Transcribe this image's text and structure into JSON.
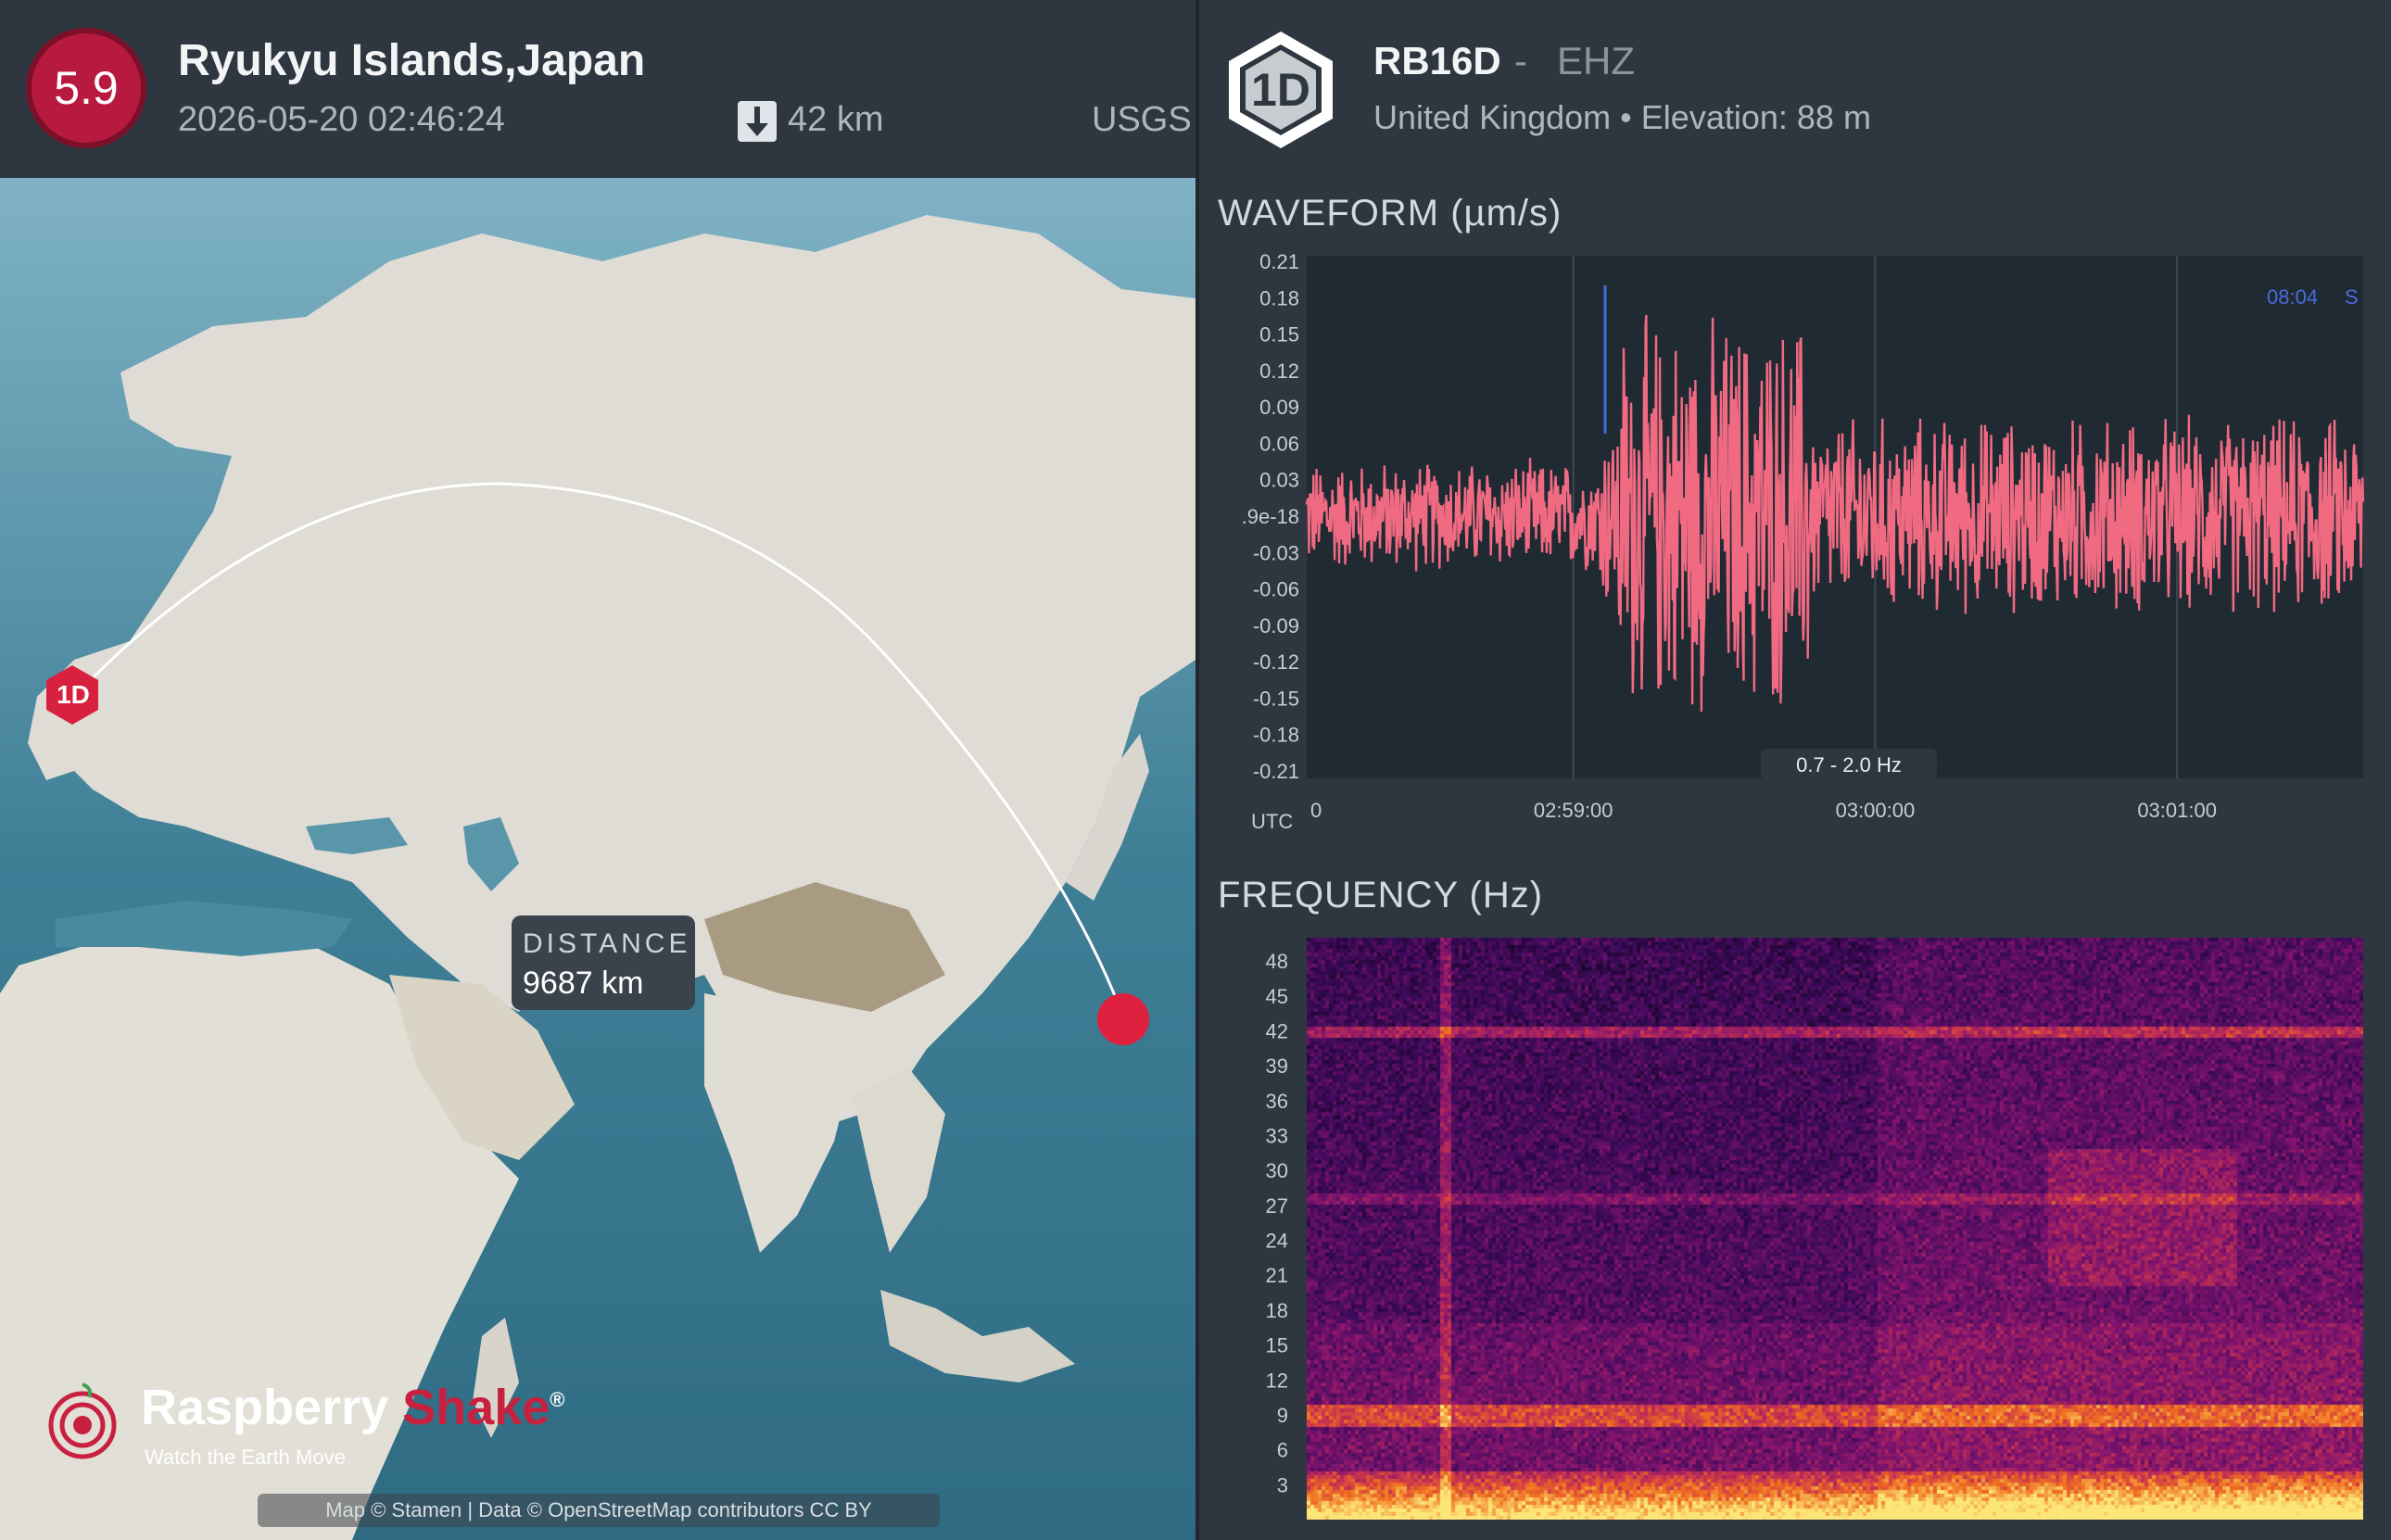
{
  "event": {
    "magnitude": "5.9",
    "location": "Ryukyu Islands,Japan",
    "datetime": "2026-05-20 02:46:24",
    "depth": "42 km",
    "source": "USGS"
  },
  "map": {
    "station_marker": "1D",
    "distance_label": "DISTANCE",
    "distance_value": "9687 km",
    "logo_name_part1": "Raspberry",
    "logo_name_part2": "Shake",
    "logo_registered": "®",
    "logo_tagline": "Watch the Earth Move",
    "attribution": "Map © Stamen | Data © OpenStreetMap contributors CC BY",
    "colors": {
      "ocean": "#4a8aa0",
      "land": "#dcdcd6",
      "epicenter": "#e0203f",
      "station": "#d8203f"
    }
  },
  "station": {
    "badge": "1D",
    "code": "RB16D",
    "separator": "-",
    "channel": "EHZ",
    "country": "United Kingdom",
    "bullet": "•",
    "elevation": "Elevation: 88 m"
  },
  "waveform": {
    "title": "WAVEFORM (µm/s)",
    "timezone": "UTC",
    "time_marker": "08:04",
    "marker_suffix": "S",
    "filter_label": "0.7 - 2.0 Hz"
  },
  "frequency": {
    "title": "FREQUENCY (Hz)"
  },
  "chart_data": [
    {
      "type": "line",
      "title": "WAVEFORM (µm/s)",
      "ylabel": "µm/s",
      "xlabel": "UTC",
      "y_tick_labels": [
        "0.21",
        "0.18",
        "0.15",
        "0.12",
        "0.09",
        "0.06",
        "0.03",
        ".9e-18",
        "-0.03",
        "-0.06",
        "-0.09",
        "-0.12",
        "-0.15",
        "-0.18",
        "-0.21"
      ],
      "x_tick_labels": [
        "0",
        "02:59:00",
        "03:00:00",
        "03:01:00"
      ],
      "ylim": [
        -0.21,
        0.21
      ],
      "x_range_seconds": [
        0,
        210
      ],
      "series": [
        {
          "color": "#f06a82",
          "envelope_segments": [
            {
              "t": [
                0,
                58
              ],
              "amplitude": 0.05
            },
            {
              "t": [
                58,
                62
              ],
              "amplitude": 0.09
            },
            {
              "t": [
                62,
                100
              ],
              "amplitude": 0.18
            },
            {
              "t": [
                100,
                210
              ],
              "amplitude": 0.09
            }
          ]
        }
      ],
      "annotations": [
        "0.7 - 2.0 Hz",
        "08:04 S"
      ],
      "grid": true
    },
    {
      "type": "heatmap",
      "title": "FREQUENCY (Hz)",
      "y_tick_labels": [
        "48",
        "45",
        "42",
        "39",
        "36",
        "33",
        "30",
        "27",
        "24",
        "21",
        "18",
        "15",
        "12",
        "9",
        "6",
        "3"
      ],
      "ylim": [
        0,
        50
      ],
      "features": [
        {
          "kind": "horizontal_line",
          "freq_hz": 42,
          "strength": "medium"
        },
        {
          "kind": "horizontal_line",
          "freq_hz": 27.5,
          "strength": "low"
        },
        {
          "kind": "band",
          "freq_hz": [
            8,
            10
          ],
          "strength": "high"
        },
        {
          "kind": "band",
          "freq_hz": [
            0,
            4
          ],
          "strength": "very high"
        },
        {
          "kind": "vertical_line",
          "t_fraction": 0.13,
          "strength": "medium"
        },
        {
          "kind": "energy_onset",
          "t_fraction": 0.54
        }
      ],
      "colormap": "inferno",
      "grid": false
    }
  ]
}
